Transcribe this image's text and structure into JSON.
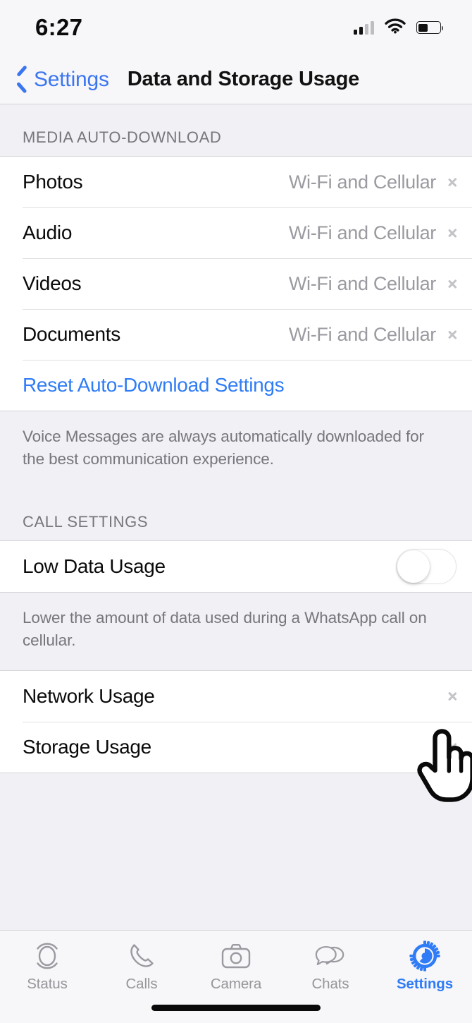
{
  "status_bar": {
    "time": "6:27",
    "cellular_icon": "cellular-bars-icon",
    "cellular_bars_filled": 2,
    "cellular_bars_total": 4,
    "wifi_icon": "wifi-icon",
    "battery_icon": "battery-icon",
    "battery_level_percent": 40
  },
  "nav": {
    "back_label": "Settings",
    "back_icon": "chevron-left-icon",
    "title": "Data and Storage Usage"
  },
  "sections": {
    "media": {
      "header": "MEDIA AUTO-DOWNLOAD",
      "rows": [
        {
          "label": "Photos",
          "value": "Wi-Fi and Cellular"
        },
        {
          "label": "Audio",
          "value": "Wi-Fi and Cellular"
        },
        {
          "label": "Videos",
          "value": "Wi-Fi and Cellular"
        },
        {
          "label": "Documents",
          "value": "Wi-Fi and Cellular"
        }
      ],
      "reset_label": "Reset Auto-Download Settings",
      "footer": "Voice Messages are always automatically downloaded for the best communication experience."
    },
    "calls": {
      "header": "CALL SETTINGS",
      "low_data_label": "Low Data Usage",
      "low_data_enabled": false,
      "footer": "Lower the amount of data used during a WhatsApp call on cellular."
    },
    "usage": {
      "rows": [
        {
          "label": "Network Usage"
        },
        {
          "label": "Storage Usage"
        }
      ]
    }
  },
  "cursor": {
    "icon": "pointing-hand-cursor"
  },
  "tabbar": {
    "items": [
      {
        "label": "Status",
        "icon": "status-ring-icon",
        "active": false
      },
      {
        "label": "Calls",
        "icon": "phone-icon",
        "active": false
      },
      {
        "label": "Camera",
        "icon": "camera-icon",
        "active": false
      },
      {
        "label": "Chats",
        "icon": "chat-bubbles-icon",
        "active": false
      },
      {
        "label": "Settings",
        "icon": "gear-icon",
        "active": true
      }
    ]
  },
  "colors": {
    "accent_blue": "#2F7CF6",
    "back_blue": "#3B76F0",
    "group_bg": "#F1F0F5",
    "cell_bg": "#FFFFFF",
    "secondary_text": "#9A9AA0",
    "header_text": "#76767C"
  }
}
